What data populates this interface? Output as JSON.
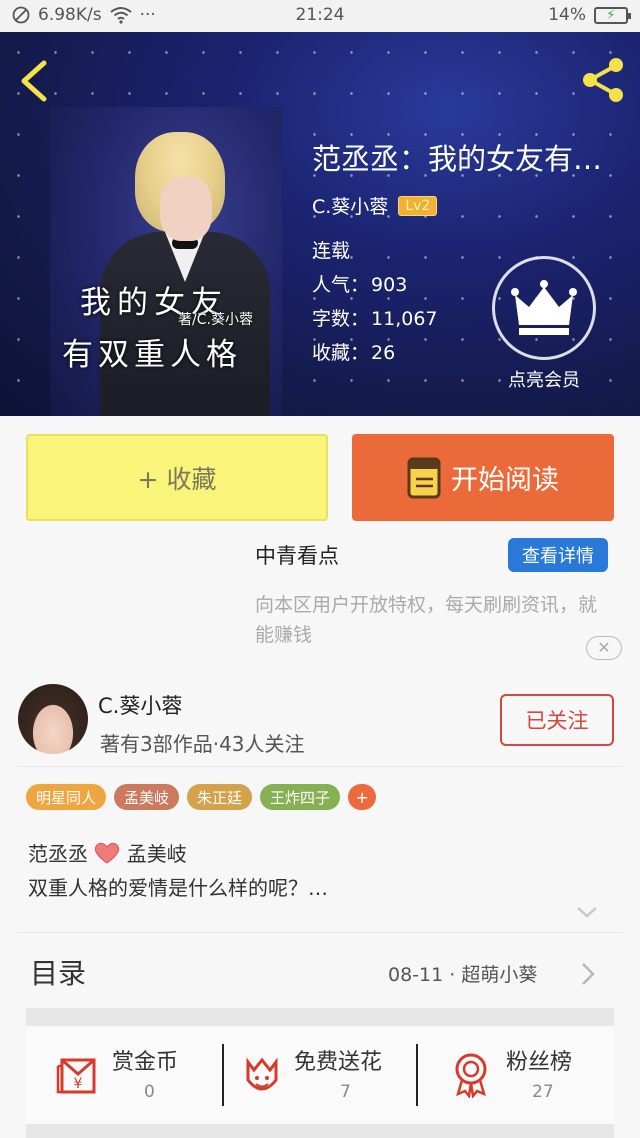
{
  "status_bar": {
    "speed": "6.98K/s",
    "dots": "···",
    "time": "21:24",
    "battery": "14%"
  },
  "header": {
    "cover": {
      "title_line1": "我的女友",
      "author_line": "著/C.葵小蓉",
      "title_line2": "有双重人格"
    },
    "book_title": "范丞丞：我的女友有…",
    "author": "C.葵小蓉",
    "level": "Lv2",
    "status": "连载",
    "popularity_label": "人气：",
    "popularity": "903",
    "words_label": "字数：",
    "words": "11,067",
    "collect_label": "收藏：",
    "collects": "26",
    "vip_label": "点亮会员"
  },
  "actions": {
    "collect": "+ 收藏",
    "read": "开始阅读"
  },
  "ad": {
    "title": "中青看点",
    "button": "查看详情",
    "description": "向本区用户开放特权，每天刷刷资讯，就能赚钱",
    "close": "✕"
  },
  "author_card": {
    "name": "C.葵小蓉",
    "stats": "著有3部作品·43人关注",
    "follow": "已关注"
  },
  "tags": [
    {
      "label": "明星同人",
      "color": "#f0a640"
    },
    {
      "label": "孟美岐",
      "color": "#cc7a5e"
    },
    {
      "label": "朱正廷",
      "color": "#d4a24a"
    },
    {
      "label": "王炸四子",
      "color": "#86b054"
    },
    {
      "label": "+",
      "color": "#ec6a3e"
    }
  ],
  "description": {
    "line1_left": "范丞丞",
    "line1_right": "孟美岐",
    "line2": "双重人格的爱情是什么样的呢？…"
  },
  "toc": {
    "label": "目录",
    "meta": "08-11 · 超萌小葵"
  },
  "stats": [
    {
      "label": "赏金币",
      "value": "0",
      "icon": "reward-coin-icon"
    },
    {
      "label": "免费送花",
      "value": "7",
      "icon": "flower-icon"
    },
    {
      "label": "粉丝榜",
      "value": "27",
      "icon": "fan-ranking-icon"
    }
  ],
  "colors": {
    "collect_button": "#fbf47a",
    "read_button": "#eb6a3a",
    "ad_button": "#2879d8",
    "follow_border": "#cf4a3a",
    "stat_icon": "#d63a2a"
  }
}
